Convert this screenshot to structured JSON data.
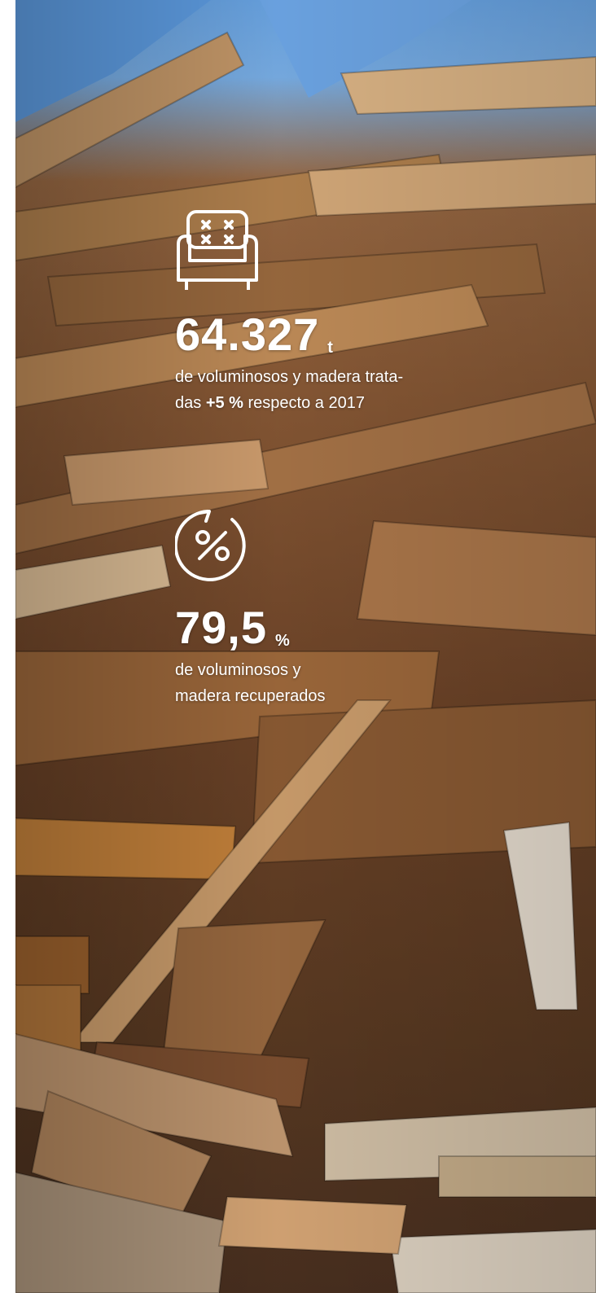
{
  "stats": [
    {
      "icon": "armchair-icon",
      "value": "64.327",
      "unit": "t",
      "desc_line1": "de voluminosos y madera trata-",
      "desc_line2_prefix": "das ",
      "desc_line2_bold": "+5 %",
      "desc_line2_suffix": " respecto a 2017"
    },
    {
      "icon": "percent-cycle-icon",
      "value": "79,5",
      "unit": "%",
      "desc_line1": "de voluminosos y",
      "desc_line2": "madera recuperados"
    }
  ],
  "colors": {
    "text": "#ffffff",
    "sky": "#6aa6e6",
    "wood": "#8a5a36"
  }
}
